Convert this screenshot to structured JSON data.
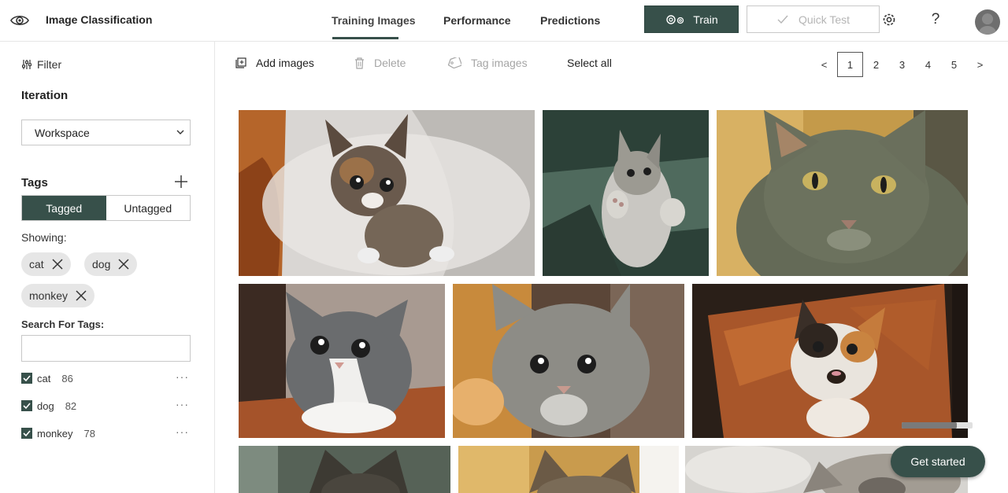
{
  "header": {
    "app_title": "Image Classification",
    "tabs": [
      {
        "label": "Training Images",
        "active": true
      },
      {
        "label": "Performance",
        "active": false
      },
      {
        "label": "Predictions",
        "active": false
      }
    ],
    "train_label": "Train",
    "quick_test_label": "Quick Test",
    "help_label": "?"
  },
  "sidebar": {
    "filter_label": "Filter",
    "iteration_heading": "Iteration",
    "iteration_selected": "Workspace",
    "tags_heading": "Tags",
    "segment": {
      "tagged": "Tagged",
      "untagged": "Untagged",
      "selected": "Tagged"
    },
    "showing_label": "Showing:",
    "chips": [
      {
        "label": "cat"
      },
      {
        "label": "dog"
      },
      {
        "label": "monkey"
      }
    ],
    "search_label": "Search For Tags:",
    "search_value": "",
    "tags": [
      {
        "name": "cat",
        "count": "86",
        "checked": true,
        "more": "···"
      },
      {
        "name": "dog",
        "count": "82",
        "checked": true,
        "more": "···"
      },
      {
        "name": "monkey",
        "count": "78",
        "checked": true,
        "more": "···"
      }
    ]
  },
  "toolbar": {
    "add_images": "Add images",
    "delete": "Delete",
    "tag_images": "Tag images",
    "select_all": "Select all"
  },
  "pagination": {
    "prev": "<",
    "next": ">",
    "pages": [
      "1",
      "2",
      "3",
      "4",
      "5"
    ],
    "current": "1"
  },
  "get_started_label": "Get started",
  "colors": {
    "accent": "#37504a",
    "border": "#c8c8c8",
    "chip_bg": "#e6e6e6"
  }
}
